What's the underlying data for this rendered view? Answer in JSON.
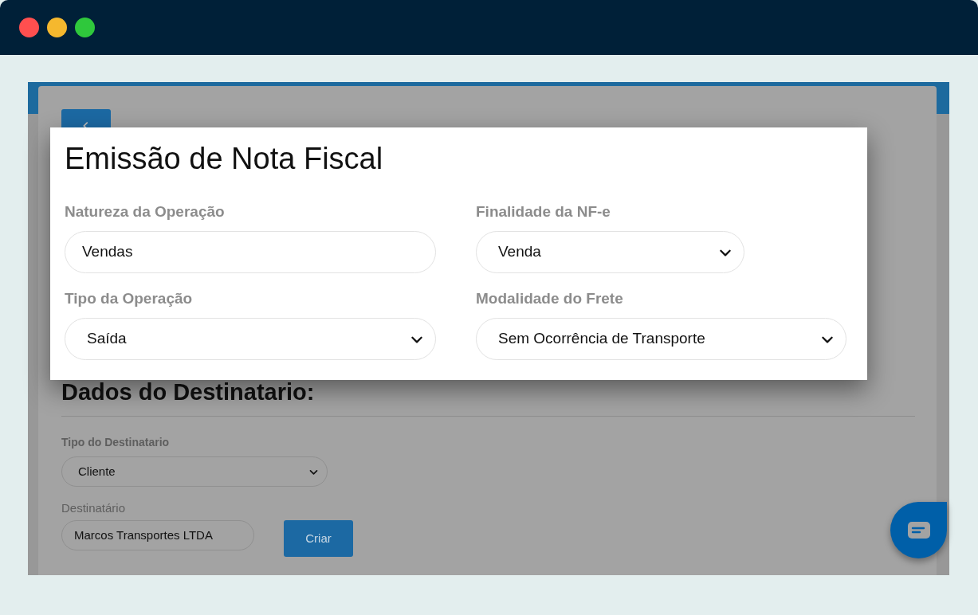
{
  "recipient_section": {
    "title": "Dados do Destinatario:",
    "fields": [
      {
        "kind": "select",
        "label": "Tipo do Destinatario",
        "value": "Cliente"
      },
      {
        "kind": "input",
        "label": "Destinatário",
        "value": "Marcos Transportes LTDA"
      }
    ],
    "create_button": "Criar"
  },
  "dialog": {
    "title": "Emissão de Nota Fiscal",
    "fields": [
      {
        "kind": "input",
        "label": "Natureza da Operação",
        "value": "Vendas"
      },
      {
        "kind": "select",
        "label": "Finalidade da NF-e",
        "value": "Venda"
      },
      {
        "kind": "select",
        "label": "Tipo da Operação",
        "value": "Saída"
      },
      {
        "kind": "select",
        "label": "Modalidade do Frete",
        "value": "Sem Ocorrência de Transporte"
      }
    ]
  }
}
